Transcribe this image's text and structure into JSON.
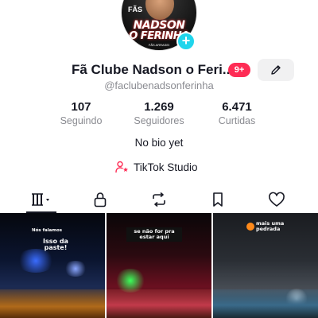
{
  "profile": {
    "avatar_alt": "Nadson o Ferinha profile picture",
    "avatar_lines": [
      "NADSON",
      "O FERINHA"
    ],
    "avatar_tag": "FÃS",
    "avatar_small": "FÃS ARRASEI",
    "add_icon": "plus-icon",
    "display_name": "Fã Clube Nadson o Feri...",
    "notification_badge": "9+",
    "edit_icon": "pencil-icon",
    "username": "@faclubenadsonferinha",
    "bio": "No bio yet"
  },
  "stats": [
    {
      "value": "107",
      "label": "Seguindo"
    },
    {
      "value": "1.269",
      "label": "Seguidores"
    },
    {
      "value": "6.471",
      "label": "Curtidas"
    }
  ],
  "studio": {
    "label": "TikTok Studio",
    "icon": "person-star-icon"
  },
  "tabs": [
    {
      "icon": "grid-icon",
      "active": true
    },
    {
      "icon": "lock-icon",
      "active": false
    },
    {
      "icon": "repost-icon",
      "active": false
    },
    {
      "icon": "bookmark-icon",
      "active": false
    },
    {
      "icon": "heart-icon",
      "active": false
    }
  ],
  "videos": [
    {
      "overlay_small": "Nós falamos",
      "overlay_main": "Isso da paste!"
    },
    {
      "overlay_main": "se não for pra estar aqui"
    },
    {
      "overlay_main": "mais uma pedrada"
    }
  ],
  "colors": {
    "accent": "#fe2c55",
    "add_button": "#20d5ec",
    "secondary_text": "#8a8b91",
    "primary_text": "#161823"
  }
}
